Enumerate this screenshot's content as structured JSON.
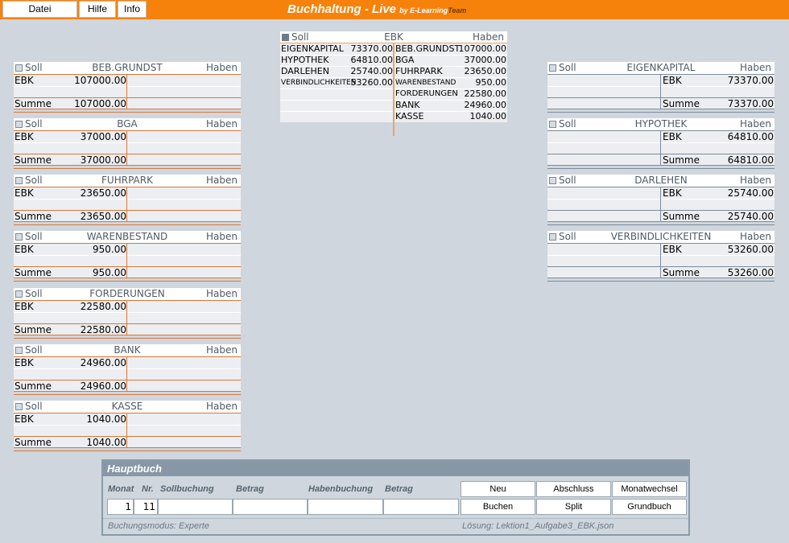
{
  "menu": {
    "datei": "Datei",
    "hilfe": "Hilfe",
    "info": "Info"
  },
  "app": {
    "title": "Buchhaltung - Live",
    "by": "by E-Learning",
    "team": "Team"
  },
  "colors": {
    "topbar": "#f7820b",
    "asset_line": "#d6783a",
    "liability_line": "#7d8b99",
    "ebk_line": "#f2a25b"
  },
  "labels": {
    "soll": "Soll",
    "haben": "Haben",
    "ebk": "EBK",
    "summe": "Summe"
  },
  "ebk": {
    "name": "EBK",
    "left": [
      {
        "name": "EIGENKAPITAL",
        "value": "73370.00"
      },
      {
        "name": "HYPOTHEK",
        "value": "64810.00"
      },
      {
        "name": "DARLEHEN",
        "value": "25740.00"
      },
      {
        "name": "VERBINDLICHKEITEN",
        "value": "53260.00"
      }
    ],
    "right": [
      {
        "name": "BEB.GRUNDST",
        "value": "107000.00"
      },
      {
        "name": "BGA",
        "value": "37000.00"
      },
      {
        "name": "FUHRPARK",
        "value": "23650.00"
      },
      {
        "name": "WARENBESTAND",
        "value": "950.00"
      },
      {
        "name": "FORDERUNGEN",
        "value": "22580.00"
      },
      {
        "name": "BANK",
        "value": "24960.00"
      },
      {
        "name": "KASSE",
        "value": "1040.00"
      }
    ]
  },
  "assets": [
    {
      "name": "BEB.GRUNDST",
      "value": "107000.00",
      "sum": "107000.00"
    },
    {
      "name": "BGA",
      "value": "37000.00",
      "sum": "37000.00"
    },
    {
      "name": "FUHRPARK",
      "value": "23650.00",
      "sum": "23650.00"
    },
    {
      "name": "WARENBESTAND",
      "value": "950.00",
      "sum": "950.00"
    },
    {
      "name": "FORDERUNGEN",
      "value": "22580.00",
      "sum": "22580.00"
    },
    {
      "name": "BANK",
      "value": "24960.00",
      "sum": "24960.00"
    },
    {
      "name": "KASSE",
      "value": "1040.00",
      "sum": "1040.00"
    }
  ],
  "liabilities": [
    {
      "name": "EIGENKAPITAL",
      "value": "73370.00",
      "sum": "73370.00"
    },
    {
      "name": "HYPOTHEK",
      "value": "64810.00",
      "sum": "64810.00"
    },
    {
      "name": "DARLEHEN",
      "value": "25740.00",
      "sum": "25740.00"
    },
    {
      "name": "VERBINDLICHKEITEN",
      "value": "53260.00",
      "sum": "53260.00"
    }
  ],
  "hauptbuch": {
    "title": "Hauptbuch",
    "col_monat": "Monat",
    "col_nr": "Nr.",
    "col_soll": "Sollbuchung",
    "col_betrag1": "Betrag",
    "col_haben": "Habenbuchung",
    "col_betrag2": "Betrag",
    "monat": "1",
    "nr": "11",
    "btn_neu": "Neu",
    "btn_abschluss": "Abschluss",
    "btn_monatswechsel": "Monatwechsel",
    "btn_buchen": "Buchen",
    "btn_split": "Split",
    "btn_grundbuch": "Grundbuch",
    "modus": "Buchungsmodus: Experte",
    "loesung": "Lösung: Lektion1_Aufgabe3_EBK.json"
  }
}
